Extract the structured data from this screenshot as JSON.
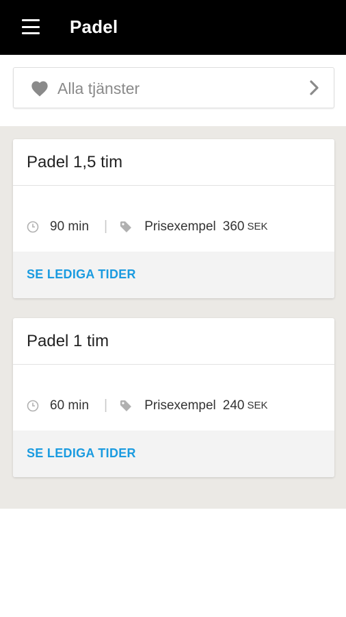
{
  "header": {
    "title": "Padel",
    "menu_icon": "hamburger-menu-icon"
  },
  "filter": {
    "icon": "heart-icon",
    "label": "Alla tjänster",
    "chevron_icon": "chevron-right-icon"
  },
  "colors": {
    "header_bg": "#000000",
    "list_bg": "#ebe9e5",
    "action": "#1a9be0"
  },
  "services": [
    {
      "title": "Padel 1,5 tim",
      "duration": "90 min",
      "price_label": "Prisexempel",
      "price": "360",
      "currency": "SEK",
      "action": "SE LEDIGA TIDER"
    },
    {
      "title": "Padel 1 tim",
      "duration": "60 min",
      "price_label": "Prisexempel",
      "price": "240",
      "currency": "SEK",
      "action": "SE LEDIGA TIDER"
    }
  ]
}
